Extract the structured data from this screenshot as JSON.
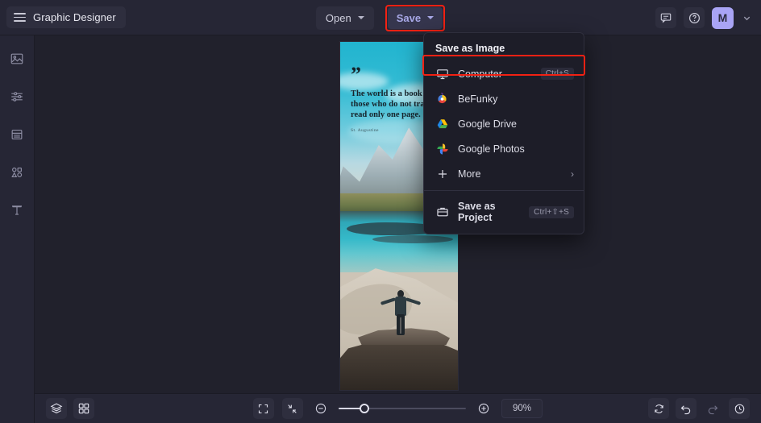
{
  "app": {
    "title": "Graphic Designer",
    "menu_icon": "hamburger-icon"
  },
  "header": {
    "open_button": "Open",
    "save_button": "Save",
    "feedback_icon": "chat-icon",
    "help_icon": "help-circle-icon",
    "avatar_initial": "M",
    "avatar_caret_icon": "chevron-down-icon"
  },
  "sidebar": {
    "items": [
      {
        "name": "image",
        "icon": "image-icon"
      },
      {
        "name": "adjust",
        "icon": "sliders-icon"
      },
      {
        "name": "templates",
        "icon": "layout-icon"
      },
      {
        "name": "graphics",
        "icon": "shapes-icon"
      },
      {
        "name": "text",
        "icon": "text-icon"
      }
    ]
  },
  "save_menu": {
    "title": "Save as Image",
    "items": [
      {
        "label": "Computer",
        "shortcut": "Ctrl+S",
        "icon": "monitor-icon",
        "highlighted": true,
        "chevron": false
      },
      {
        "label": "BeFunky",
        "shortcut": "",
        "icon": "befunky-icon",
        "highlighted": false,
        "chevron": false
      },
      {
        "label": "Google Drive",
        "shortcut": "",
        "icon": "google-drive-icon",
        "highlighted": false,
        "chevron": false
      },
      {
        "label": "Google Photos",
        "shortcut": "",
        "icon": "google-photos-icon",
        "highlighted": false,
        "chevron": false
      },
      {
        "label": "More",
        "shortcut": "",
        "icon": "plus-icon",
        "highlighted": false,
        "chevron": true
      }
    ],
    "project_item": {
      "label": "Save as Project",
      "shortcut": "Ctrl+⇧+S",
      "icon": "briefcase-icon"
    }
  },
  "canvas": {
    "quote_mark": "”",
    "quote_text": "The world is a book and those who do not travel read only one page.",
    "quote_author": "St. Augustine"
  },
  "footer": {
    "layers_icon": "layers-icon",
    "grid_icon": "grid-icon",
    "fullscreen_icon": "fullscreen-icon",
    "fit_icon": "fit-screen-icon",
    "zoom_out_icon": "minus-circle-icon",
    "zoom_in_icon": "plus-circle-icon",
    "zoom_value": "90%",
    "zoom_percent": 20,
    "reset_icon": "reset-icon",
    "undo_icon": "undo-icon",
    "redo_icon": "redo-icon",
    "history_icon": "history-icon"
  },
  "colors": {
    "accent_red": "#f22113",
    "header_bg": "#262635",
    "workspace_bg": "#21212c",
    "menu_bg": "#1d1d28",
    "save_text": "#a9a9e8",
    "avatar_bg": "#a9a4f5"
  }
}
